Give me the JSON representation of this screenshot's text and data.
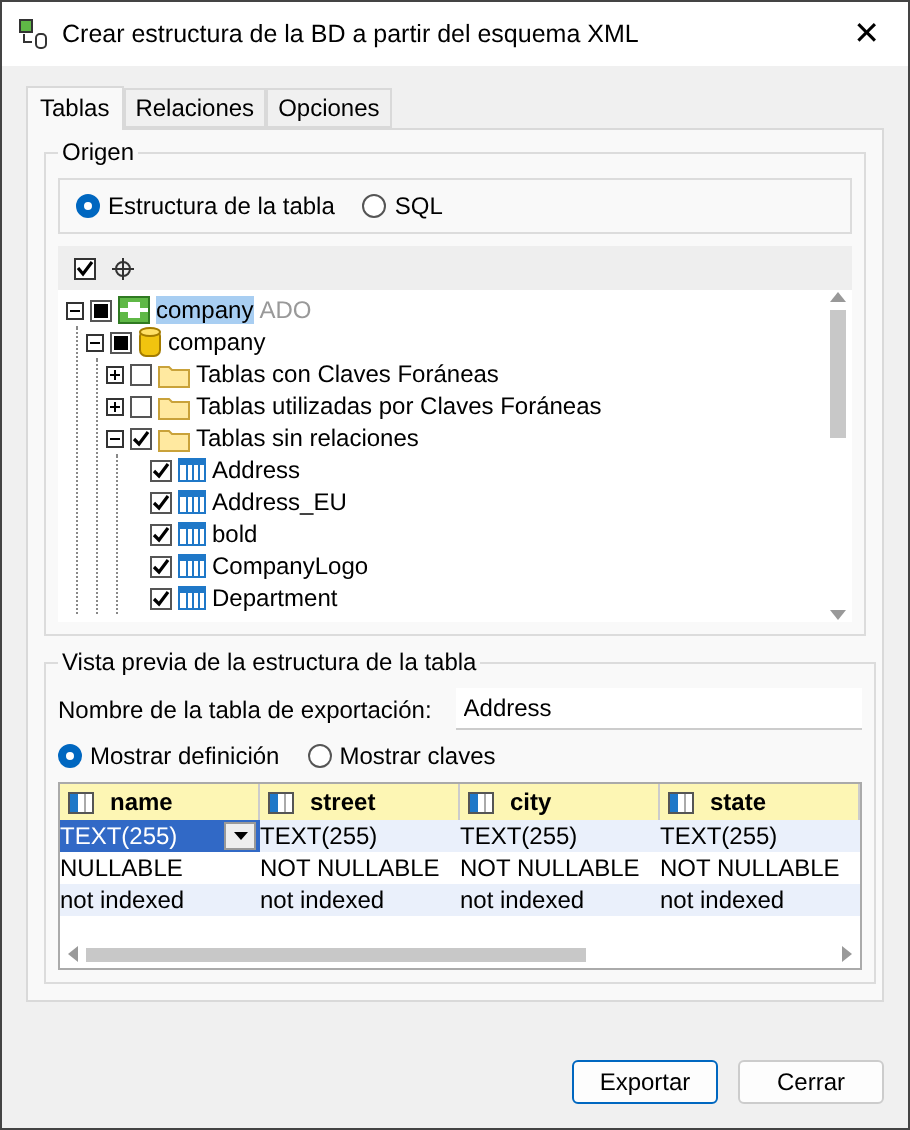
{
  "window": {
    "title": "Crear estructura de la BD a partir del esquema XML",
    "close": "✕"
  },
  "tabs": [
    {
      "label": "Tablas",
      "selected": true
    },
    {
      "label": "Relaciones",
      "selected": false
    },
    {
      "label": "Opciones",
      "selected": false
    }
  ],
  "origin": {
    "title": "Origen",
    "modes": [
      {
        "label": "Estructura de la tabla",
        "selected": true
      },
      {
        "label": "SQL",
        "selected": false
      }
    ],
    "tree": [
      {
        "kind": "connection",
        "label": "company",
        "suffix": "ADO",
        "checked": false,
        "partial": true,
        "expanded": true,
        "selected": true,
        "children": [
          {
            "kind": "database",
            "label": "company",
            "checked": false,
            "partial": true,
            "expanded": true,
            "selected": false,
            "children": [
              {
                "kind": "folder",
                "label": "Tablas con Claves Foráneas",
                "checked": false,
                "partial": false,
                "expanded": false,
                "selected": false
              },
              {
                "kind": "folder",
                "label": "Tablas utilizadas por Claves Foráneas",
                "checked": false,
                "partial": false,
                "expanded": false,
                "selected": false
              },
              {
                "kind": "folder",
                "label": "Tablas sin relaciones",
                "checked": true,
                "partial": false,
                "expanded": true,
                "selected": false,
                "children": [
                  {
                    "kind": "table",
                    "label": "Address",
                    "checked": true,
                    "selected": false
                  },
                  {
                    "kind": "table",
                    "label": "Address_EU",
                    "checked": true,
                    "selected": false
                  },
                  {
                    "kind": "table",
                    "label": "bold",
                    "checked": true,
                    "selected": false
                  },
                  {
                    "kind": "table",
                    "label": "CompanyLogo",
                    "checked": true,
                    "selected": false
                  },
                  {
                    "kind": "table",
                    "label": "Department",
                    "checked": true,
                    "selected": false
                  }
                ]
              }
            ]
          }
        ]
      }
    ]
  },
  "preview": {
    "title": "Vista previa de la estructura de la tabla",
    "name_label": "Nombre de la tabla de exportación:",
    "name_value": "Address",
    "views": [
      {
        "label": "Mostrar definición",
        "selected": true
      },
      {
        "label": "Mostrar claves",
        "selected": false
      }
    ],
    "columns": [
      "name",
      "street",
      "city",
      "state"
    ],
    "rows": [
      {
        "cells": [
          {
            "text": "TEXT(255)",
            "selected": true
          },
          {
            "text": "TEXT(255)",
            "selected": false
          },
          {
            "text": "TEXT(255)",
            "selected": false
          },
          {
            "text": "TEXT(255)",
            "selected": false
          }
        ]
      },
      {
        "cells": [
          {
            "text": "NULLABLE",
            "selected": false
          },
          {
            "text": "NOT NULLABLE",
            "selected": false
          },
          {
            "text": "NOT NULLABLE",
            "selected": false
          },
          {
            "text": "NOT NULLABLE",
            "selected": false
          }
        ]
      },
      {
        "cells": [
          {
            "text": "not indexed",
            "selected": false
          },
          {
            "text": "not indexed",
            "selected": false
          },
          {
            "text": "not indexed",
            "selected": false
          },
          {
            "text": "not indexed",
            "selected": false
          }
        ]
      }
    ]
  },
  "buttons": [
    {
      "label": "Exportar",
      "default": true
    },
    {
      "label": "Cerrar",
      "default": false
    }
  ]
}
